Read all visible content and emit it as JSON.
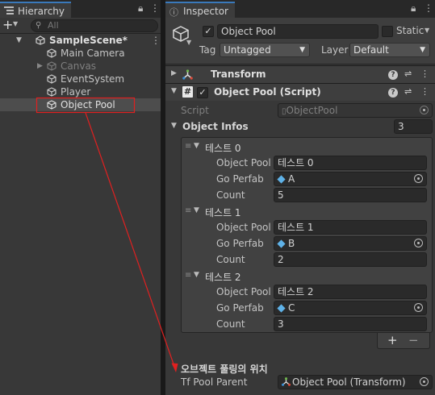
{
  "hierarchy": {
    "tab_label": "Hierarchy",
    "search_placeholder": "All",
    "scene": "SampleScene*",
    "items": [
      {
        "label": "Main Camera"
      },
      {
        "label": "Canvas"
      },
      {
        "label": "EventSystem"
      },
      {
        "label": "Player"
      },
      {
        "label": "Object Pool"
      }
    ]
  },
  "inspector": {
    "tab_label": "Inspector",
    "object_name": "Object Pool",
    "static_label": "Static",
    "tag_label": "Tag",
    "tag_value": "Untagged",
    "layer_label": "Layer",
    "layer_value": "Default",
    "transform_title": "Transform",
    "script_component_title": "Object Pool (Script)",
    "script_label": "Script",
    "script_value": "ObjectPool",
    "object_infos_label": "Object Infos",
    "object_infos_count": "3",
    "elements": [
      {
        "title": "테스트 0",
        "name_label": "Object Pool I",
        "name_value": "테스트 0",
        "prefab_label": "Go Perfab",
        "prefab_value": "A",
        "count_label": "Count",
        "count_value": "5"
      },
      {
        "title": "테스트 1",
        "name_label": "Object Pool I",
        "name_value": "테스트 1",
        "prefab_label": "Go Perfab",
        "prefab_value": "B",
        "count_label": "Count",
        "count_value": "2"
      },
      {
        "title": "테스트 2",
        "name_label": "Object Pool I",
        "name_value": "테스트 2",
        "prefab_label": "Go Perfab",
        "prefab_value": "C",
        "count_label": "Count",
        "count_value": "3"
      }
    ],
    "add_label": "+",
    "remove_label": "−",
    "section_header": "오브젝트 풀링의 위치",
    "pool_parent_label": "Tf Pool Parent",
    "pool_parent_value": "Object Pool (Transform)"
  },
  "colors": {
    "annotation": "#e02020",
    "accent_tab": "#3a79bb",
    "prefab_icon": "#5fb2e8"
  }
}
